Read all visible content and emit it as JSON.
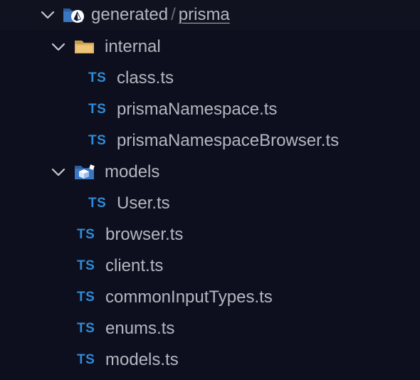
{
  "header": {
    "folder_label": "generated",
    "separator": "/",
    "active_label": "prisma",
    "folder_icon": "prisma-folder-icon"
  },
  "tree": {
    "internal": {
      "label": "internal",
      "icon": "folder-open-icon",
      "files": [
        {
          "label": "class.ts",
          "badge": "TS"
        },
        {
          "label": "prismaNamespace.ts",
          "badge": "TS"
        },
        {
          "label": "prismaNamespaceBrowser.ts",
          "badge": "TS"
        }
      ]
    },
    "models": {
      "label": "models",
      "icon": "models-folder-icon",
      "files": [
        {
          "label": "User.ts",
          "badge": "TS"
        }
      ]
    },
    "root_files": [
      {
        "label": "browser.ts",
        "badge": "TS"
      },
      {
        "label": "client.ts",
        "badge": "TS"
      },
      {
        "label": "commonInputTypes.ts",
        "badge": "TS"
      },
      {
        "label": "enums.ts",
        "badge": "TS"
      },
      {
        "label": "models.ts",
        "badge": "TS"
      }
    ]
  },
  "colors": {
    "background": "#0d0f1e",
    "ts_badge": "#2f8bd6",
    "text": "#b4b6c0",
    "folder": "#e3b667"
  }
}
